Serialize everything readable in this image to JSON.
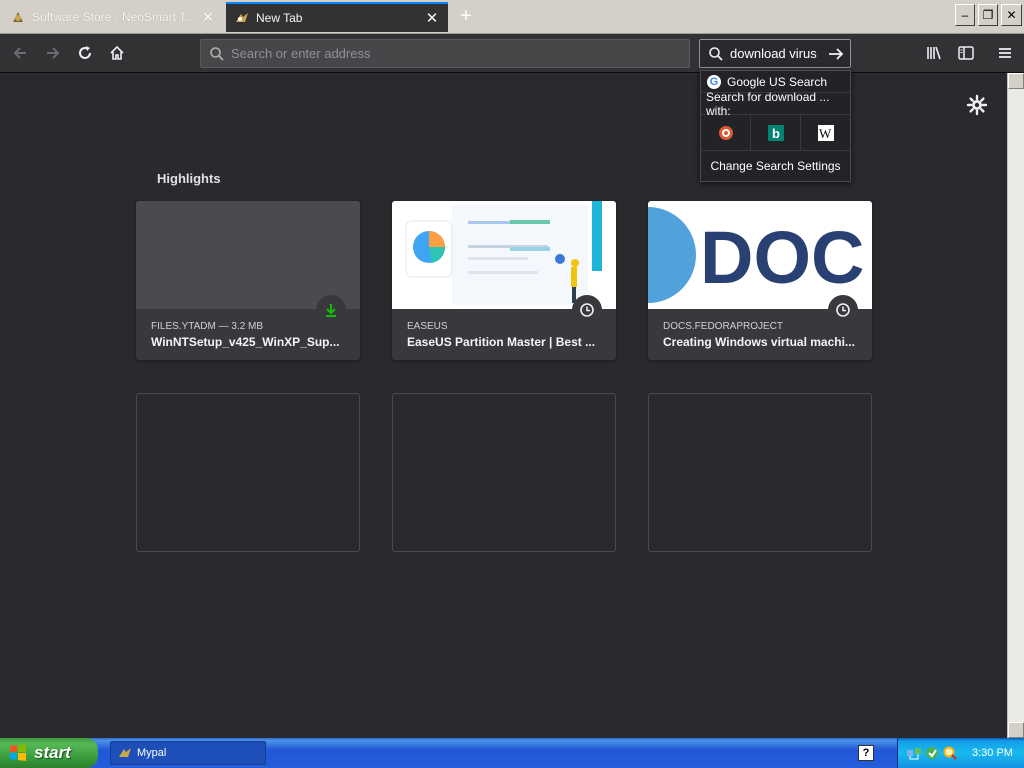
{
  "tabs": [
    {
      "title": "Software Store - NeoSmart Techno",
      "active": false
    },
    {
      "title": "New Tab",
      "active": true
    }
  ],
  "window_controls": {
    "min": "–",
    "restore": "❐",
    "close": "✕"
  },
  "urlbar": {
    "placeholder": "Search or enter address"
  },
  "searchbar": {
    "value": "download virus"
  },
  "search_popup": {
    "google": "Google US Search",
    "header": "Search for download ... with:",
    "engines": [
      "duckduckgo-icon",
      "bing-icon",
      "wikipedia-icon"
    ],
    "settings": "Change Search Settings"
  },
  "highlights": {
    "title": "Highlights",
    "cards": [
      {
        "meta": "FILES.YTADM — 3.2 MB",
        "title": "WinNTSetup_v425_WinXP_Sup...",
        "badge": "download-icon"
      },
      {
        "meta": "EASEUS",
        "title": "EaseUS Partition Master | Best ...",
        "badge": "clock-icon"
      },
      {
        "meta": "DOCS.FEDORAPROJECT",
        "title": "Creating Windows virtual machi...",
        "badge": "clock-icon",
        "thumb_text": "DOC"
      }
    ]
  },
  "taskbar": {
    "start_label": "start",
    "task_label": "Mypal",
    "clock": "3:30 PM",
    "help": "?"
  },
  "colors": {
    "accent": "#0a84ff",
    "background": "#2a2a2e",
    "download_green": "#12bc00"
  }
}
